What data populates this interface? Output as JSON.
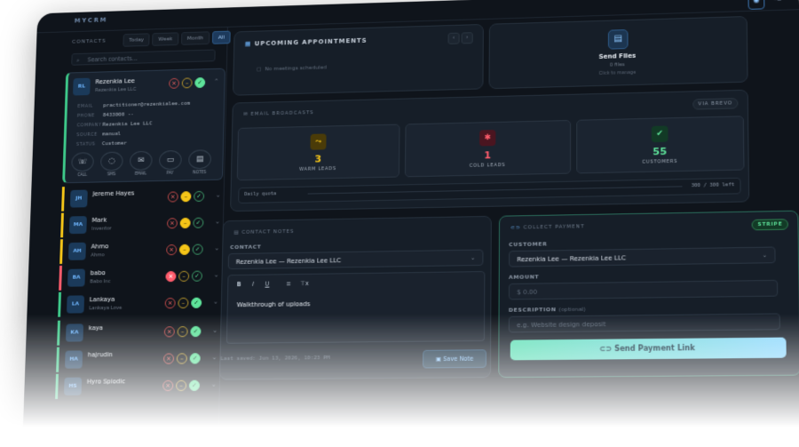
{
  "app": {
    "brand": "MYCRM"
  },
  "topbar": {
    "settings_icon": "gear-icon",
    "logout_icon": "logout-icon"
  },
  "sidebar": {
    "title": "CONTACTS",
    "filters": [
      {
        "label": "Today",
        "active": false
      },
      {
        "label": "Week",
        "active": false
      },
      {
        "label": "Month",
        "active": false
      },
      {
        "label": "All",
        "active": true
      }
    ],
    "search_placeholder": "Search contacts...",
    "selected_contact": {
      "initials": "RL",
      "name": "Rezenkia Lee",
      "company": "Rezenkia Lee LLC",
      "details": [
        {
          "label": "EMAIL",
          "value": "practitioner@rezenkialee.com"
        },
        {
          "label": "PHONE",
          "value": "8433000 --"
        },
        {
          "label": "COMPANY",
          "value": "Rezenkia Lee LLC"
        },
        {
          "label": "SOURCE",
          "value": "manual"
        },
        {
          "label": "STATUS",
          "value": "Customer"
        }
      ],
      "actions": [
        "CALL",
        "SMS",
        "EMAIL",
        "PAY",
        "NOTES"
      ]
    },
    "contacts": [
      {
        "initials": "JH",
        "name": "Jereme Hayes",
        "sub": "",
        "status": "yellow",
        "accent": "#f5c518"
      },
      {
        "initials": "MA",
        "name": "Mark",
        "sub": "Inventor",
        "status": "yellow",
        "accent": "#f5c518"
      },
      {
        "initials": "AH",
        "name": "Ahmo",
        "sub": "Ahmo",
        "status": "yellow",
        "accent": "#f5c518"
      },
      {
        "initials": "BA",
        "name": "babo",
        "sub": "Babo Inc",
        "status": "red",
        "accent": "#ff5c6c"
      },
      {
        "initials": "LA",
        "name": "Lankaya",
        "sub": "Lankaya Love",
        "status": "green",
        "accent": "#3ec98a"
      },
      {
        "initials": "KA",
        "name": "kaya",
        "sub": "",
        "status": "green",
        "accent": "#3ec98a"
      },
      {
        "initials": "HA",
        "name": "hajrudin",
        "sub": "",
        "status": "green",
        "accent": "#3ec98a"
      },
      {
        "initials": "HS",
        "name": "Hyro Spiodic",
        "sub": "",
        "status": "green",
        "accent": "#3ec98a"
      }
    ]
  },
  "appointments": {
    "title": "UPCOMING APPOINTMENTS",
    "empty": "No meetings scheduled"
  },
  "send_files": {
    "title": "Send Files",
    "count": "0 files",
    "hint": "Click to manage"
  },
  "broadcasts": {
    "title": "EMAIL BROADCASTS",
    "badge": "VIA BREVO",
    "stats": [
      {
        "value": "3",
        "label": "WARM LEADS",
        "color": "#f5c518",
        "icon": "flame-icon"
      },
      {
        "value": "1",
        "label": "COLD LEADS",
        "color": "#ff5c6c",
        "icon": "snowflake-icon"
      },
      {
        "value": "55",
        "label": "CUSTOMERS",
        "color": "#5ee39a",
        "icon": "verified-icon"
      }
    ],
    "quota_label": "Daily quota",
    "quota_value": "300 / 300 left"
  },
  "notes": {
    "title": "CONTACT NOTES",
    "contact_label": "CONTACT",
    "contact_value": "Rezenkia Lee — Rezenkia Lee LLC",
    "toolbar": [
      "B",
      "I",
      "U",
      "≡",
      "⊤x"
    ],
    "body": "Walkthrough of uploads",
    "last_saved": "Last saved: Jun 13, 2026, 10:23 PM",
    "save_label": "Save Note"
  },
  "payment": {
    "title": "COLLECT PAYMENT",
    "badge": "STRIPE",
    "customer_label": "CUSTOMER",
    "customer_value": "Rezenkia Lee — Rezenkia Lee LLC",
    "amount_label": "AMOUNT",
    "amount_placeholder": "$ 0.00",
    "description_label": "DESCRIPTION",
    "description_optional": "(optional)",
    "description_placeholder": "e.g. Website design deposit",
    "button_label": "Send Payment Link"
  }
}
